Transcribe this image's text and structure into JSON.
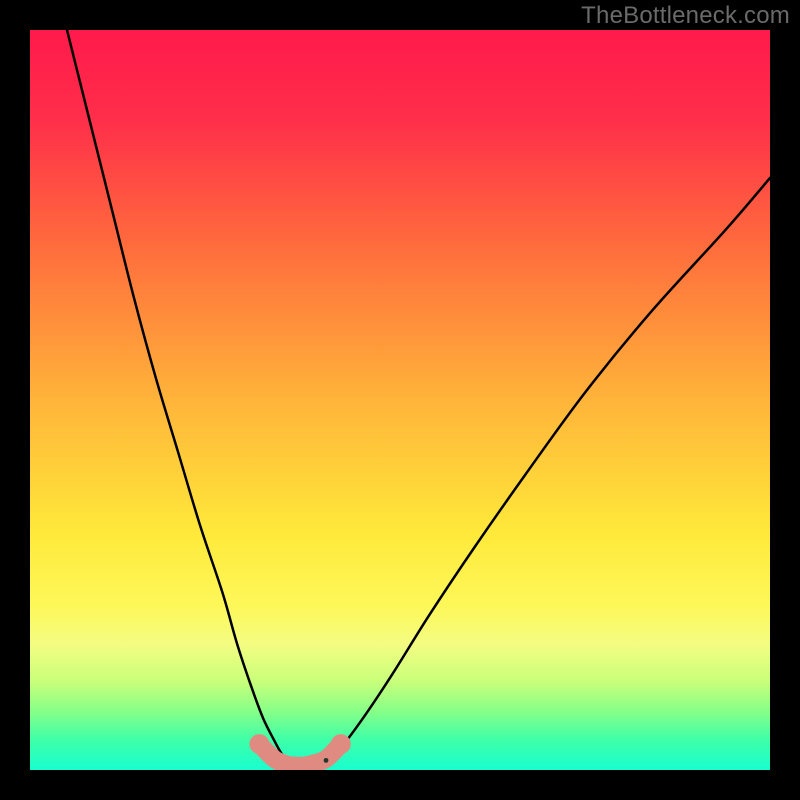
{
  "watermark": "TheBottleneck.com",
  "chart_data": {
    "type": "line",
    "title": "",
    "xlabel": "",
    "ylabel": "",
    "xlim": [
      0,
      100
    ],
    "ylim": [
      0,
      100
    ],
    "grid": false,
    "legend": false,
    "gradient_stops": [
      {
        "offset": 0.0,
        "color": "#ff1a4b"
      },
      {
        "offset": 0.12,
        "color": "#ff2e4a"
      },
      {
        "offset": 0.3,
        "color": "#ff6f3c"
      },
      {
        "offset": 0.5,
        "color": "#ffb43a"
      },
      {
        "offset": 0.68,
        "color": "#ffe93a"
      },
      {
        "offset": 0.78,
        "color": "#fdf85a"
      },
      {
        "offset": 0.83,
        "color": "#f4fd82"
      },
      {
        "offset": 0.88,
        "color": "#c9ff7a"
      },
      {
        "offset": 0.92,
        "color": "#88ff88"
      },
      {
        "offset": 0.96,
        "color": "#3dffa8"
      },
      {
        "offset": 1.0,
        "color": "#19ffd0"
      }
    ],
    "series": [
      {
        "name": "left-branch",
        "type": "curve",
        "x": [
          5,
          8,
          11,
          14,
          17,
          20,
          23,
          26,
          28,
          30,
          31.5,
          33,
          34,
          35
        ],
        "y": [
          100,
          88,
          76,
          64,
          53,
          43,
          33,
          24,
          17,
          11,
          7,
          4,
          2.2,
          1.0
        ]
      },
      {
        "name": "right-branch",
        "type": "curve",
        "x": [
          40,
          42,
          45,
          49,
          54,
          60,
          67,
          75,
          84,
          94,
          100
        ],
        "y": [
          1.0,
          3,
          7,
          13,
          21,
          30,
          40,
          51,
          62,
          73,
          80
        ]
      },
      {
        "name": "optimal-band",
        "type": "marker",
        "x": [
          31,
          33,
          34.5,
          35.5,
          37,
          38,
          40,
          42
        ],
        "y": [
          3.5,
          1.5,
          0.8,
          0.6,
          0.6,
          0.8,
          1.5,
          3.5
        ]
      }
    ]
  }
}
